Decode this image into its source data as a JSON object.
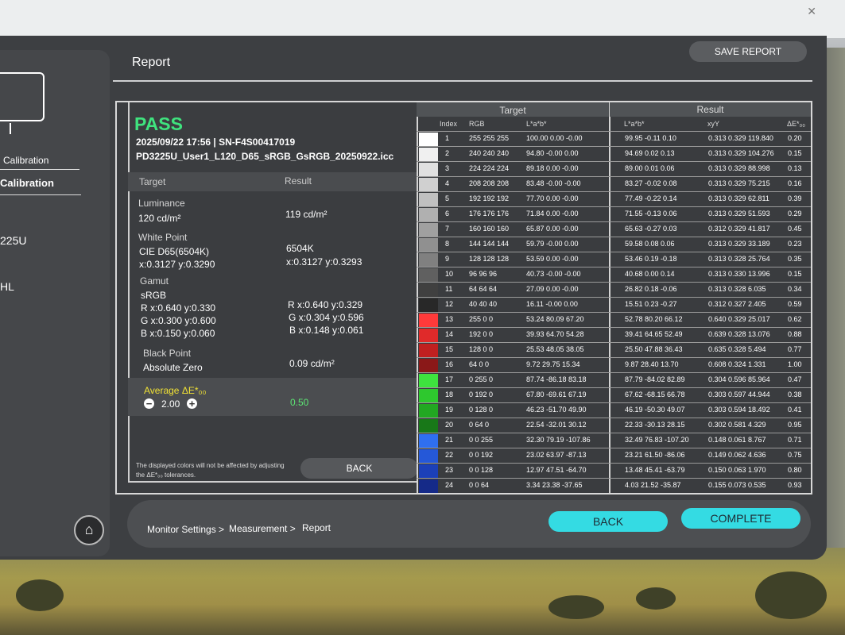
{
  "header": {
    "title": "Report",
    "save_label": "SAVE REPORT"
  },
  "sidebar": {
    "item1": "Calibration",
    "item2": "Calibration",
    "item3": "225U",
    "item4": "HL"
  },
  "summary": {
    "status": "PASS",
    "datetime_serial": "2025/09/22 17:56 | SN-F4S00417019",
    "profile": "PD3225U_User1_L120_D65_sRGB_GsRGB_20250922.icc",
    "target_header": "Target",
    "result_header": "Result",
    "luminance_label": "Luminance",
    "luminance_target": "120 cd/m²",
    "luminance_result": "119 cd/m²",
    "whitepoint_label": "White Point",
    "whitepoint_target1": "CIE D65(6504K)",
    "whitepoint_target2": "x:0.3127 y:0.3290",
    "whitepoint_result1": "6504K",
    "whitepoint_result2": "x:0.3127 y:0.3293",
    "gamut_label": "Gamut",
    "gamut_target": "sRGB",
    "gamut_t_r": "R x:0.640 y:0.330",
    "gamut_t_g": "G x:0.300 y:0.600",
    "gamut_t_b": "B x:0.150 y:0.060",
    "gamut_r_r": "R x:0.640 y:0.329",
    "gamut_r_g": "G x:0.304 y:0.596",
    "gamut_r_b": "B x:0.148 y:0.061",
    "blackpoint_label": "Black Point",
    "blackpoint_target": "Absolute Zero",
    "blackpoint_result": "0.09 cd/m²",
    "avg_label": "Average ΔE*₀₀",
    "avg_tolerance": "2.00",
    "avg_result": "0.50",
    "note": "The displayed colors will not be affected by adjusting the ΔE*₀₀ tolerances.",
    "back_label": "BACK"
  },
  "table": {
    "target_header": "Target",
    "result_header": "Result",
    "col_index": "Index",
    "col_rgb": "RGB",
    "col_lab": "L*a*b*",
    "col_lab_res": "L*a*b*",
    "col_xyy": "xyY",
    "col_de": "ΔE*₀₀",
    "rows": [
      {
        "swatch": "#ffffff",
        "index": "1",
        "rgb": "255 255 255",
        "lab": "100.00 0.00 -0.00",
        "res_lab": "99.95 -0.11 0.10",
        "xyy": "0.313 0.329 119.840",
        "de": "0.20"
      },
      {
        "swatch": "#f0f0f0",
        "index": "2",
        "rgb": "240 240 240",
        "lab": "94.80 -0.00 0.00",
        "res_lab": "94.69 0.02 0.13",
        "xyy": "0.313 0.329 104.276",
        "de": "0.15"
      },
      {
        "swatch": "#e0e0e0",
        "index": "3",
        "rgb": "224 224 224",
        "lab": "89.18 0.00 -0.00",
        "res_lab": "89.00 0.01 0.06",
        "xyy": "0.313 0.329 88.998",
        "de": "0.13"
      },
      {
        "swatch": "#d0d0d0",
        "index": "4",
        "rgb": "208 208 208",
        "lab": "83.48 -0.00 -0.00",
        "res_lab": "83.27 -0.02 0.08",
        "xyy": "0.313 0.329 75.215",
        "de": "0.16"
      },
      {
        "swatch": "#c0c0c0",
        "index": "5",
        "rgb": "192 192 192",
        "lab": "77.70 0.00 -0.00",
        "res_lab": "77.49 -0.22 0.14",
        "xyy": "0.313 0.329 62.811",
        "de": "0.39"
      },
      {
        "swatch": "#b0b0b0",
        "index": "6",
        "rgb": "176 176 176",
        "lab": "71.84 0.00 -0.00",
        "res_lab": "71.55 -0.13 0.06",
        "xyy": "0.313 0.329 51.593",
        "de": "0.29"
      },
      {
        "swatch": "#a0a0a0",
        "index": "7",
        "rgb": "160 160 160",
        "lab": "65.87 0.00 -0.00",
        "res_lab": "65.63 -0.27 0.03",
        "xyy": "0.312 0.329 41.817",
        "de": "0.45"
      },
      {
        "swatch": "#909090",
        "index": "8",
        "rgb": "144 144 144",
        "lab": "59.79 -0.00 0.00",
        "res_lab": "59.58 0.08 0.06",
        "xyy": "0.313 0.329 33.189",
        "de": "0.23"
      },
      {
        "swatch": "#808080",
        "index": "9",
        "rgb": "128 128 128",
        "lab": "53.59 0.00 -0.00",
        "res_lab": "53.46 0.19 -0.18",
        "xyy": "0.313 0.328 25.764",
        "de": "0.35"
      },
      {
        "swatch": "#606060",
        "index": "10",
        "rgb": "96 96 96",
        "lab": "40.73 -0.00 -0.00",
        "res_lab": "40.68 0.00 0.14",
        "xyy": "0.313 0.330 13.996",
        "de": "0.15"
      },
      {
        "swatch": "#404040",
        "index": "11",
        "rgb": "64 64 64",
        "lab": "27.09 0.00 -0.00",
        "res_lab": "26.82 0.18 -0.06",
        "xyy": "0.313 0.328 6.035",
        "de": "0.34"
      },
      {
        "swatch": "#282828",
        "index": "12",
        "rgb": "40 40 40",
        "lab": "16.11 -0.00 0.00",
        "res_lab": "15.51 0.23 -0.27",
        "xyy": "0.312 0.327 2.405",
        "de": "0.59"
      },
      {
        "swatch": "#ff3a3a",
        "index": "13",
        "rgb": "255 0 0",
        "lab": "53.24 80.09 67.20",
        "res_lab": "52.78 80.20 66.12",
        "xyy": "0.640 0.329 25.017",
        "de": "0.62"
      },
      {
        "swatch": "#e02a2a",
        "index": "14",
        "rgb": "192 0 0",
        "lab": "39.93 64.70 54.28",
        "res_lab": "39.41 64.65 52.49",
        "xyy": "0.639 0.328 13.076",
        "de": "0.88"
      },
      {
        "swatch": "#c02020",
        "index": "15",
        "rgb": "128 0 0",
        "lab": "25.53 48.05 38.05",
        "res_lab": "25.50 47.88 36.43",
        "xyy": "0.635 0.328 5.494",
        "de": "0.77"
      },
      {
        "swatch": "#8a1818",
        "index": "16",
        "rgb": "64 0 0",
        "lab": "9.72 29.75 15.34",
        "res_lab": "9.87 28.40 13.70",
        "xyy": "0.608 0.324 1.331",
        "de": "1.00"
      },
      {
        "swatch": "#3ee33e",
        "index": "17",
        "rgb": "0 255 0",
        "lab": "87.74 -86.18 83.18",
        "res_lab": "87.79 -84.02 82.89",
        "xyy": "0.304 0.596 85.964",
        "de": "0.47"
      },
      {
        "swatch": "#2ec82e",
        "index": "18",
        "rgb": "0 192 0",
        "lab": "67.80 -69.61 67.19",
        "res_lab": "67.62 -68.15 66.78",
        "xyy": "0.303 0.597 44.944",
        "de": "0.38"
      },
      {
        "swatch": "#22a822",
        "index": "19",
        "rgb": "0 128 0",
        "lab": "46.23 -51.70 49.90",
        "res_lab": "46.19 -50.30 49.07",
        "xyy": "0.303 0.594 18.492",
        "de": "0.41"
      },
      {
        "swatch": "#187818",
        "index": "20",
        "rgb": "0 64 0",
        "lab": "22.54 -32.01 30.12",
        "res_lab": "22.33 -30.13 28.15",
        "xyy": "0.302 0.581 4.329",
        "de": "0.95"
      },
      {
        "swatch": "#2f6ff0",
        "index": "21",
        "rgb": "0 0 255",
        "lab": "32.30 79.19 -107.86",
        "res_lab": "32.49 76.83 -107.20",
        "xyy": "0.148 0.061 8.767",
        "de": "0.71"
      },
      {
        "swatch": "#2558d8",
        "index": "22",
        "rgb": "0 0 192",
        "lab": "23.02 63.97 -87.13",
        "res_lab": "23.21 61.50 -86.06",
        "xyy": "0.149 0.062 4.636",
        "de": "0.75"
      },
      {
        "swatch": "#1c40b8",
        "index": "23",
        "rgb": "0 0 128",
        "lab": "12.97 47.51 -64.70",
        "res_lab": "13.48 45.41 -63.79",
        "xyy": "0.150 0.063 1.970",
        "de": "0.80"
      },
      {
        "swatch": "#152a88",
        "index": "24",
        "rgb": "0 0 64",
        "lab": "3.34 23.38 -37.65",
        "res_lab": "4.03 21.52 -35.87",
        "xyy": "0.155 0.073 0.535",
        "de": "0.93"
      }
    ]
  },
  "breadcrumb": {
    "step1": "Monitor Settings >",
    "step2": "Measurement >",
    "step3": "Report"
  },
  "footer": {
    "back_label": "BACK",
    "complete_label": "COMPLETE"
  },
  "icons": {
    "home": "home-icon",
    "close": "close-icon"
  },
  "colors": {
    "pass": "#3fe37e",
    "accent": "#34dbe3",
    "avg_label": "#f0e135"
  }
}
